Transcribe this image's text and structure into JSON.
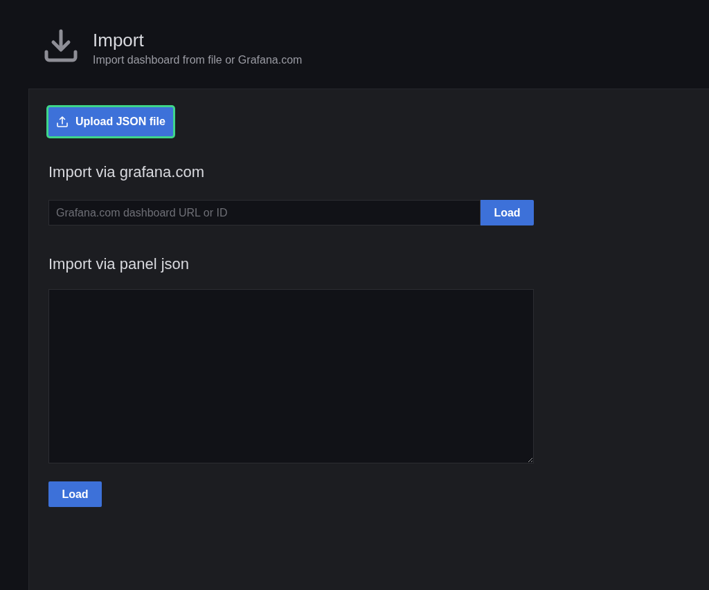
{
  "header": {
    "title": "Import",
    "subtitle": "Import dashboard from file or Grafana.com"
  },
  "upload_button": {
    "label": "Upload JSON file",
    "focused": true
  },
  "grafana_section": {
    "heading": "Import via grafana.com",
    "input": {
      "placeholder": "Grafana.com dashboard URL or ID"
    },
    "button": "Load"
  },
  "json_section": {
    "heading": "Import via panel json",
    "button": "Load"
  }
}
